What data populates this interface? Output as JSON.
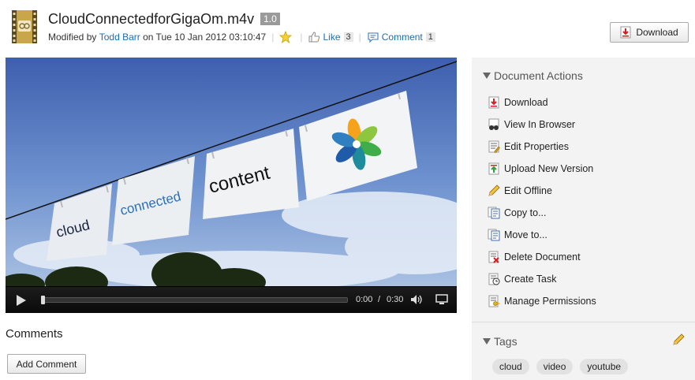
{
  "document": {
    "file_name": "CloudConnectedforGigaOm.m4v",
    "version": "1.0",
    "modified_prefix": "Modified by",
    "modified_user": "Todd Barr",
    "modified_on": "on Tue 10 Jan 2012 03:10:47",
    "like_label": "Like",
    "like_count": "3",
    "comment_label": "Comment",
    "comment_count": "1",
    "download_button": "Download"
  },
  "player": {
    "slide_texts": [
      "cloud",
      "connected",
      "content"
    ],
    "current_time": "0:00",
    "time_separator": "/",
    "duration": "0:30",
    "progress": 0
  },
  "comments": {
    "title": "Comments",
    "add_button": "Add Comment"
  },
  "sidebar": {
    "actions_title": "Document Actions",
    "actions": [
      {
        "label": "Download",
        "icon": "download-icon"
      },
      {
        "label": "View In Browser",
        "icon": "view-browser-icon"
      },
      {
        "label": "Edit Properties",
        "icon": "edit-properties-icon"
      },
      {
        "label": "Upload New Version",
        "icon": "upload-icon"
      },
      {
        "label": "Edit Offline",
        "icon": "pencil-icon"
      },
      {
        "label": "Copy to...",
        "icon": "copy-icon"
      },
      {
        "label": "Move to...",
        "icon": "move-icon"
      },
      {
        "label": "Delete Document",
        "icon": "delete-icon"
      },
      {
        "label": "Create Task",
        "icon": "task-icon"
      },
      {
        "label": "Manage Permissions",
        "icon": "permissions-icon"
      }
    ],
    "tags_title": "Tags",
    "tags": [
      "cloud",
      "video",
      "youtube"
    ]
  },
  "colors": {
    "link": "#1a6fb3",
    "sidebar_bg": "#f3f3f3",
    "tag_bg": "#e2e2e2"
  }
}
